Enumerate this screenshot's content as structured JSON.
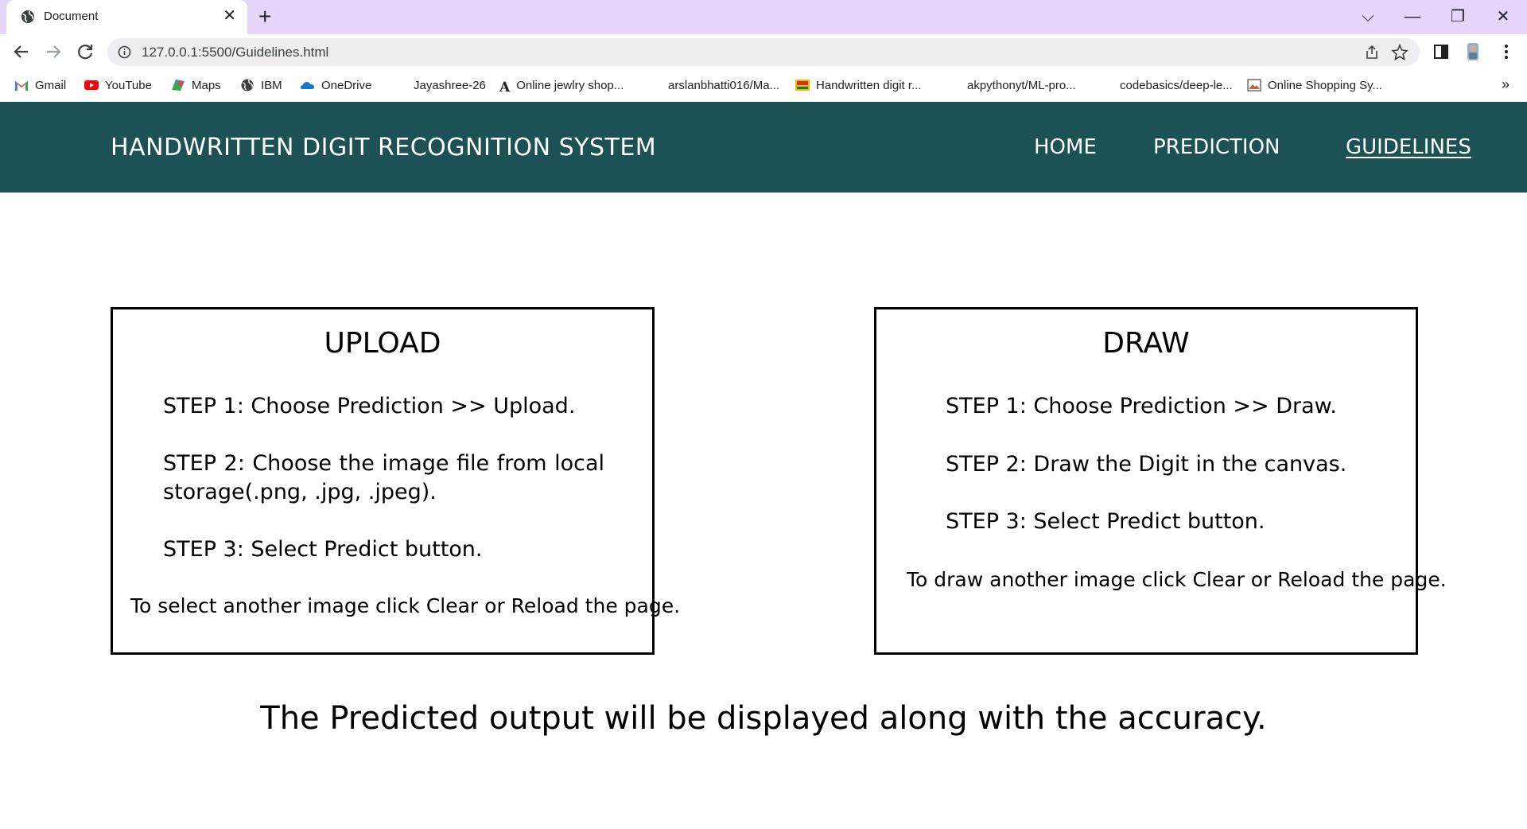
{
  "browser": {
    "tab_title": "Document",
    "url": "127.0.0.1:5500/Guidelines.html",
    "bookmarks": [
      {
        "label": "Gmail",
        "icon": "gmail-icon"
      },
      {
        "label": "YouTube",
        "icon": "youtube-icon"
      },
      {
        "label": "Maps",
        "icon": "maps-icon"
      },
      {
        "label": "IBM",
        "icon": "globe-icon"
      },
      {
        "label": "OneDrive",
        "icon": "onedrive-icon"
      },
      {
        "label": "Jayashree-26",
        "icon": "github-icon"
      },
      {
        "label": "Online jewlry shop...",
        "icon": "font-a-icon"
      },
      {
        "label": "arslanbhatti016/Ma...",
        "icon": "github-icon"
      },
      {
        "label": "Handwritten digit r...",
        "icon": "image-icon"
      },
      {
        "label": "akpythonyt/ML-pro...",
        "icon": "github-icon"
      },
      {
        "label": "codebasics/deep-le...",
        "icon": "github-icon"
      },
      {
        "label": "Online Shopping Sy...",
        "icon": "image-icon"
      }
    ],
    "more_bookmarks": "»"
  },
  "navbar": {
    "brand": "HANDWRITTEN DIGIT RECOGNITION SYSTEM",
    "links": [
      "HOME",
      "PREDICTION",
      "GUIDELINES"
    ],
    "active": "GUIDELINES"
  },
  "upload": {
    "title": "UPLOAD",
    "step1": "STEP 1: Choose Prediction >> Upload.",
    "step2": "STEP 2: Choose the image file from local storage(.png, .jpg, .jpeg).",
    "step3": "STEP 3: Select Predict button.",
    "note": "To select another image click Clear or Reload the page."
  },
  "draw": {
    "title": "DRAW",
    "step1": "STEP 1: Choose Prediction >> Draw.",
    "step2": "STEP 2: Draw the Digit in the canvas.",
    "step3": "STEP 3: Select Predict button.",
    "note": "To draw another image click Clear or Reload the page."
  },
  "footer": {
    "text": "The Predicted output will be displayed along with the accuracy."
  },
  "colors": {
    "tabbar": "#e5d5fb",
    "navbar": "#1c5253",
    "card_border": "#000000"
  }
}
